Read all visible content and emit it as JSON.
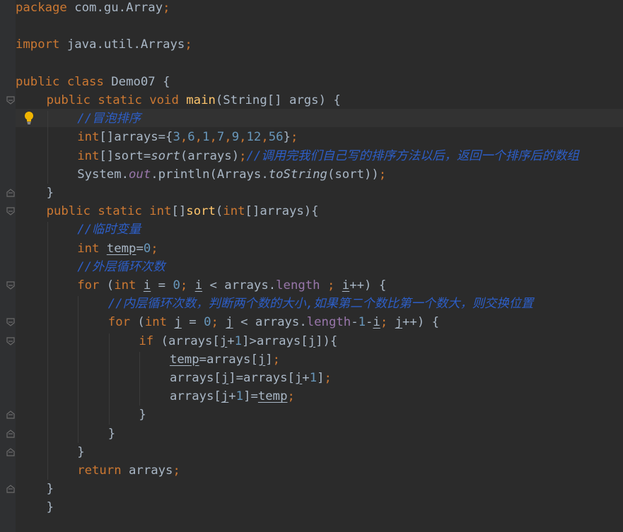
{
  "editor": {
    "language": "java",
    "theme_colors": {
      "background": "#2b2b2b",
      "keyword": "#cc7832",
      "number": "#6897bb",
      "comment": "#2d5fc9",
      "method_declaration": "#ffc66d",
      "field": "#9876aa",
      "default_text": "#a9b7c6"
    },
    "intention_icon": "lightbulb-icon",
    "fold_icon": "fold-marker-icon",
    "lines": [
      {
        "indent": 0,
        "tokens": [
          {
            "t": "package",
            "c": "kw"
          },
          {
            "t": " com.gu.Array",
            "c": ""
          },
          {
            "t": ";",
            "c": "kw"
          }
        ]
      },
      {
        "indent": 0,
        "tokens": []
      },
      {
        "indent": 0,
        "tokens": [
          {
            "t": "import",
            "c": "kw"
          },
          {
            "t": " java.util.Arrays",
            "c": ""
          },
          {
            "t": ";",
            "c": "kw"
          }
        ]
      },
      {
        "indent": 0,
        "tokens": []
      },
      {
        "indent": 0,
        "tokens": [
          {
            "t": "public class",
            "c": "kw"
          },
          {
            "t": " Demo07 {",
            "c": ""
          }
        ]
      },
      {
        "indent": 1,
        "fold": true,
        "tokens": [
          {
            "t": "public static void",
            "c": "kw"
          },
          {
            "t": " ",
            "c": ""
          },
          {
            "t": "main",
            "c": "fn"
          },
          {
            "t": "(String[] args) {",
            "c": ""
          }
        ]
      },
      {
        "indent": 2,
        "bulb": true,
        "tokens": [
          {
            "t": "//冒泡排序",
            "c": "cmt"
          }
        ]
      },
      {
        "indent": 2,
        "tokens": [
          {
            "t": "int",
            "c": "kw"
          },
          {
            "t": "[]arrays={",
            "c": ""
          },
          {
            "t": "3",
            "c": "num"
          },
          {
            "t": ",",
            "c": "kw"
          },
          {
            "t": "6",
            "c": "num"
          },
          {
            "t": ",",
            "c": "kw"
          },
          {
            "t": "1",
            "c": "num"
          },
          {
            "t": ",",
            "c": "kw"
          },
          {
            "t": "7",
            "c": "num"
          },
          {
            "t": ",",
            "c": "kw"
          },
          {
            "t": "9",
            "c": "num"
          },
          {
            "t": ",",
            "c": "kw"
          },
          {
            "t": "12",
            "c": "num"
          },
          {
            "t": ",",
            "c": "kw"
          },
          {
            "t": "56",
            "c": "num"
          },
          {
            "t": "}",
            "c": ""
          },
          {
            "t": ";",
            "c": "kw"
          }
        ]
      },
      {
        "indent": 2,
        "tokens": [
          {
            "t": "int",
            "c": "kw"
          },
          {
            "t": "[]sort=",
            "c": ""
          },
          {
            "t": "sort",
            "c": "it"
          },
          {
            "t": "(arrays)",
            "c": ""
          },
          {
            "t": ";",
            "c": "kw"
          },
          {
            "t": "//调用完我们自己写的排序方法以后，返回一个排序后的数组",
            "c": "cmt"
          }
        ]
      },
      {
        "indent": 2,
        "tokens": [
          {
            "t": "System.",
            "c": ""
          },
          {
            "t": "out",
            "c": "fld it"
          },
          {
            "t": ".println(Arrays.",
            "c": ""
          },
          {
            "t": "toString",
            "c": "it"
          },
          {
            "t": "(sort))",
            "c": ""
          },
          {
            "t": ";",
            "c": "kw"
          }
        ]
      },
      {
        "indent": 1,
        "fold": true,
        "tokens": [
          {
            "t": "}",
            "c": ""
          }
        ]
      },
      {
        "indent": 1,
        "fold": true,
        "tokens": [
          {
            "t": "public static ",
            "c": "kw"
          },
          {
            "t": "int",
            "c": "kw"
          },
          {
            "t": "[]",
            "c": ""
          },
          {
            "t": "sort",
            "c": "fn"
          },
          {
            "t": "(",
            "c": ""
          },
          {
            "t": "int",
            "c": "kw"
          },
          {
            "t": "[]arrays){",
            "c": ""
          }
        ]
      },
      {
        "indent": 2,
        "tokens": [
          {
            "t": "//临时变量",
            "c": "cmt"
          }
        ]
      },
      {
        "indent": 2,
        "tokens": [
          {
            "t": "int",
            "c": "kw"
          },
          {
            "t": " ",
            "c": ""
          },
          {
            "t": "temp",
            "c": "ul"
          },
          {
            "t": "=",
            "c": ""
          },
          {
            "t": "0",
            "c": "num"
          },
          {
            "t": ";",
            "c": "kw"
          }
        ]
      },
      {
        "indent": 2,
        "tokens": [
          {
            "t": "//外层循环次数",
            "c": "cmt"
          }
        ]
      },
      {
        "indent": 2,
        "fold": true,
        "tokens": [
          {
            "t": "for",
            "c": "kw"
          },
          {
            "t": " (",
            "c": ""
          },
          {
            "t": "int",
            "c": "kw"
          },
          {
            "t": " ",
            "c": ""
          },
          {
            "t": "i",
            "c": "ul"
          },
          {
            "t": " = ",
            "c": ""
          },
          {
            "t": "0",
            "c": "num"
          },
          {
            "t": "; ",
            "c": "kw"
          },
          {
            "t": "i",
            "c": "ul"
          },
          {
            "t": " < arrays.",
            "c": ""
          },
          {
            "t": "length",
            "c": "fld"
          },
          {
            "t": " ; ",
            "c": "kw"
          },
          {
            "t": "i",
            "c": "ul"
          },
          {
            "t": "++) {",
            "c": ""
          }
        ]
      },
      {
        "indent": 3,
        "tokens": [
          {
            "t": "//内层循环次数，判断两个数的大小,如果第二个数比第一个数大，则交换位置",
            "c": "cmt"
          }
        ]
      },
      {
        "indent": 3,
        "fold": true,
        "tokens": [
          {
            "t": "for",
            "c": "kw"
          },
          {
            "t": " (",
            "c": ""
          },
          {
            "t": "int",
            "c": "kw"
          },
          {
            "t": " ",
            "c": ""
          },
          {
            "t": "j",
            "c": "ul"
          },
          {
            "t": " = ",
            "c": ""
          },
          {
            "t": "0",
            "c": "num"
          },
          {
            "t": "; ",
            "c": "kw"
          },
          {
            "t": "j",
            "c": "ul"
          },
          {
            "t": " < arrays.",
            "c": ""
          },
          {
            "t": "length",
            "c": "fld"
          },
          {
            "t": "-",
            "c": ""
          },
          {
            "t": "1",
            "c": "num"
          },
          {
            "t": "-",
            "c": ""
          },
          {
            "t": "i",
            "c": "ul"
          },
          {
            "t": "; ",
            "c": "kw"
          },
          {
            "t": "j",
            "c": "ul"
          },
          {
            "t": "++) {",
            "c": ""
          }
        ]
      },
      {
        "indent": 4,
        "fold": true,
        "tokens": [
          {
            "t": "if",
            "c": "kw"
          },
          {
            "t": " (arrays[",
            "c": ""
          },
          {
            "t": "j",
            "c": "ul"
          },
          {
            "t": "+",
            "c": ""
          },
          {
            "t": "1",
            "c": "num"
          },
          {
            "t": "]>arrays[",
            "c": ""
          },
          {
            "t": "j",
            "c": "ul"
          },
          {
            "t": "]){",
            "c": ""
          }
        ]
      },
      {
        "indent": 5,
        "tokens": [
          {
            "t": "temp",
            "c": "ul"
          },
          {
            "t": "=arrays[",
            "c": ""
          },
          {
            "t": "j",
            "c": "ul"
          },
          {
            "t": "]",
            "c": ""
          },
          {
            "t": ";",
            "c": "kw"
          }
        ]
      },
      {
        "indent": 5,
        "tokens": [
          {
            "t": "arrays[",
            "c": ""
          },
          {
            "t": "j",
            "c": "ul"
          },
          {
            "t": "]=arrays[",
            "c": ""
          },
          {
            "t": "j",
            "c": "ul"
          },
          {
            "t": "+",
            "c": ""
          },
          {
            "t": "1",
            "c": "num"
          },
          {
            "t": "]",
            "c": ""
          },
          {
            "t": ";",
            "c": "kw"
          }
        ]
      },
      {
        "indent": 5,
        "tokens": [
          {
            "t": "arrays[",
            "c": ""
          },
          {
            "t": "j",
            "c": "ul"
          },
          {
            "t": "+",
            "c": ""
          },
          {
            "t": "1",
            "c": "num"
          },
          {
            "t": "]=",
            "c": ""
          },
          {
            "t": "temp",
            "c": "ul"
          },
          {
            "t": ";",
            "c": "kw"
          }
        ]
      },
      {
        "indent": 4,
        "fold": true,
        "tokens": [
          {
            "t": "}",
            "c": ""
          }
        ]
      },
      {
        "indent": 3,
        "fold": true,
        "tokens": [
          {
            "t": "}",
            "c": ""
          }
        ]
      },
      {
        "indent": 2,
        "fold": true,
        "tokens": [
          {
            "t": "}",
            "c": ""
          }
        ]
      },
      {
        "indent": 2,
        "tokens": [
          {
            "t": "return",
            "c": "kw"
          },
          {
            "t": " arrays",
            "c": ""
          },
          {
            "t": ";",
            "c": "kw"
          }
        ]
      },
      {
        "indent": 1,
        "fold": true,
        "tokens": [
          {
            "t": "}",
            "c": ""
          }
        ]
      },
      {
        "indent": 1,
        "tokens": [
          {
            "t": "}",
            "c": ""
          }
        ]
      }
    ]
  }
}
